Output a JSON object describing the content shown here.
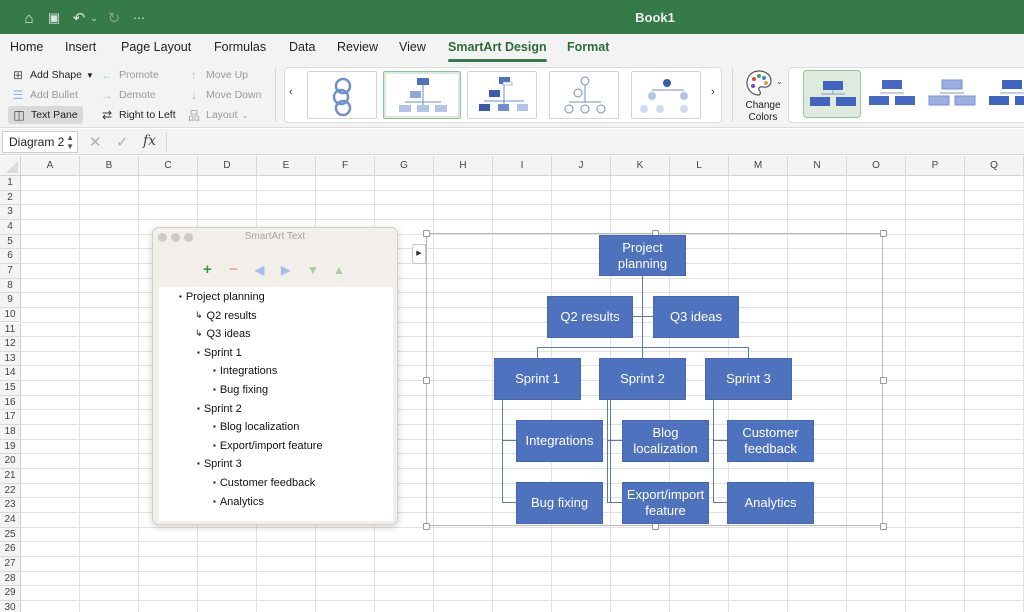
{
  "titlebar": {
    "title": "Book1",
    "quick_access": [
      "home-icon",
      "save-icon",
      "undo-icon",
      "undo-dropdown-icon",
      "redo-icon",
      "more-icon"
    ]
  },
  "tabs": [
    "Home",
    "Insert",
    "Page Layout",
    "Formulas",
    "Data",
    "Review",
    "View",
    "SmartArt Design",
    "Format"
  ],
  "active_tab": "SmartArt Design",
  "ribbon": {
    "add_shape": "Add Shape",
    "add_bullet": "Add Bullet",
    "text_pane": "Text Pane",
    "promote": "Promote",
    "demote": "Demote",
    "right_to_left": "Right to Left",
    "move_up": "Move Up",
    "move_down": "Move Down",
    "layout": "Layout",
    "change_colors_line1": "Change",
    "change_colors_line2": "Colors",
    "gallery_prev": "‹",
    "gallery_next": "›",
    "layout_gallery": [
      "Circular Process",
      "Organization Chart",
      "Name and Title Org Chart",
      "Circle Picture Hierarchy",
      "Hierarchy"
    ],
    "selected_layout": "Organization Chart",
    "styles_gallery_count": 4
  },
  "formula_bar": {
    "name_box": "Diagram 2",
    "cancel": "✕",
    "enter": "✓",
    "fx": "fx",
    "value": ""
  },
  "grid": {
    "columns": [
      "A",
      "B",
      "C",
      "D",
      "E",
      "F",
      "G",
      "H",
      "I",
      "J",
      "K",
      "L",
      "M",
      "N",
      "O",
      "P",
      "Q"
    ],
    "rows": [
      "1",
      "2",
      "3",
      "4",
      "5",
      "6",
      "7",
      "8",
      "9",
      "10",
      "11",
      "12",
      "13",
      "14",
      "15",
      "16",
      "17",
      "18",
      "19",
      "20",
      "21",
      "22",
      "23",
      "24",
      "25",
      "26",
      "27",
      "28",
      "29",
      "30"
    ]
  },
  "text_pane": {
    "title": "SmartArt Text",
    "tools": {
      "add": "+",
      "remove": "−",
      "promote": "◀",
      "demote": "▶",
      "move_down": "▼",
      "move_up": "▲"
    },
    "items": [
      {
        "text": "Project planning",
        "bullet": "▪",
        "level": 0
      },
      {
        "text": "Q2 results",
        "bullet": "↳",
        "level": 1
      },
      {
        "text": "Q3 ideas",
        "bullet": "↳",
        "level": 1
      },
      {
        "text": "Sprint 1",
        "bullet": "▪",
        "level": 1
      },
      {
        "text": "Integrations",
        "bullet": "▪",
        "level": 2
      },
      {
        "text": "Bug fixing",
        "bullet": "▪",
        "level": 2
      },
      {
        "text": "Sprint 2",
        "bullet": "▪",
        "level": 1
      },
      {
        "text": "Blog localization",
        "bullet": "▪",
        "level": 2
      },
      {
        "text": "Export/import feature",
        "bullet": "▪",
        "level": 2
      },
      {
        "text": "Sprint 3",
        "bullet": "▪",
        "level": 1
      },
      {
        "text": "Customer feedback",
        "bullet": "▪",
        "level": 2
      },
      {
        "text": "Analytics",
        "bullet": "▪",
        "level": 2
      }
    ]
  },
  "diagram": {
    "fill_color": "#4f72be",
    "root": "Project planning",
    "assistants": [
      "Q2 results",
      "Q3 ideas"
    ],
    "sprints": [
      {
        "name": "Sprint 1",
        "children": [
          "Integrations",
          "Bug fixing"
        ]
      },
      {
        "name": "Sprint 2",
        "children": [
          "Blog localization",
          "Export/import feature"
        ]
      },
      {
        "name": "Sprint 3",
        "children": [
          "Customer feedback",
          "Analytics"
        ]
      }
    ]
  }
}
